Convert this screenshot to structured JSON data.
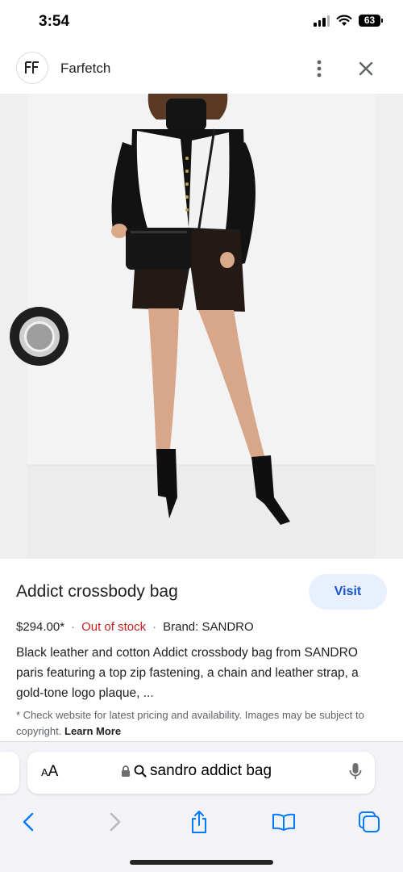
{
  "status": {
    "time": "3:54",
    "battery": "63",
    "icons": [
      "signal-icon",
      "wifi-icon",
      "battery-icon"
    ]
  },
  "header": {
    "site_name": "Farfetch",
    "logo_icon": "farfetch-logo-icon",
    "more_icon": "more-vertical-icon",
    "close_icon": "close-icon"
  },
  "image": {
    "shutter_icon": "lens-shutter-icon",
    "lens_icon": "lens-search-icon"
  },
  "result": {
    "title": "Addict crossbody bag",
    "visit_label": "Visit",
    "price": "$294.00*",
    "separator": "·",
    "stock": "Out of stock",
    "brand": "Brand: SANDRO",
    "description": "Black leather and cotton Addict crossbody bag from SANDRO paris featuring a top zip fastening, a chain and leather strap, a gold-tone logo plaque, ...",
    "disclaimer": "* Check website for latest pricing and availability. Images may be subject to copyright.",
    "learn_more": "Learn More",
    "colors": {
      "visit_bg": "#e8f0fe",
      "visit_text": "#1a56c7",
      "stock": "#c5221f"
    }
  },
  "browser": {
    "aa_label_small": "A",
    "aa_label_big": "A",
    "url": "sandro addict bag",
    "icons": [
      "lock-icon",
      "search-icon",
      "mic-icon",
      "back-icon",
      "forward-icon",
      "share-icon",
      "bookmarks-icon",
      "tabs-icon"
    ],
    "accent": "#007aff"
  }
}
